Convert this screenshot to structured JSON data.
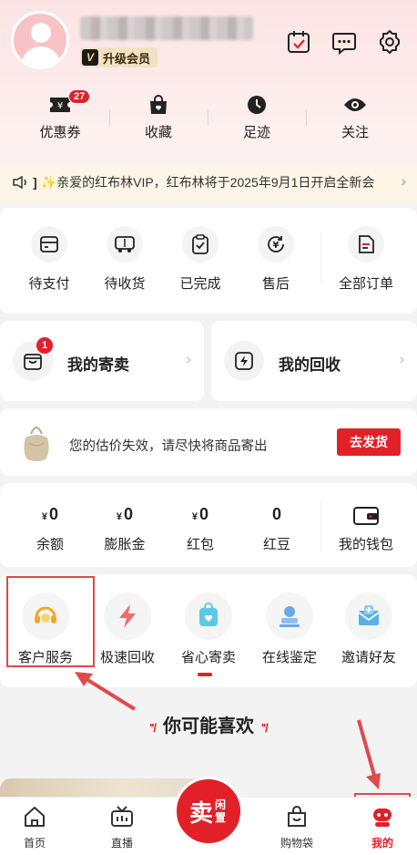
{
  "header": {
    "vip_label": "升级会员",
    "vip_icon_letter": "V"
  },
  "stats": {
    "coupon_label": "优惠券",
    "coupon_count": "27",
    "favorites_label": "收藏",
    "history_label": "足迹",
    "follow_label": "关注"
  },
  "notice": {
    "text": "✨亲爱的红布林VIP，红布林将于2025年9月1日开启全新会"
  },
  "orders": {
    "items": [
      {
        "label": "待支付"
      },
      {
        "label": "待收货"
      },
      {
        "label": "已完成"
      },
      {
        "label": "售后"
      },
      {
        "label": "全部订单"
      }
    ]
  },
  "consign": {
    "label": "我的寄卖",
    "badge": "1"
  },
  "recycle": {
    "label": "我的回收"
  },
  "alert": {
    "text": "您的估价失效，请尽快将商品寄出",
    "button": "去发货"
  },
  "wallet": {
    "currency": "¥",
    "items": [
      {
        "value": "0",
        "label": "余额"
      },
      {
        "value": "0",
        "label": "膨胀金"
      },
      {
        "value": "0",
        "label": "红包"
      },
      {
        "value": "0",
        "label": "红豆"
      }
    ],
    "wallet_label": "我的钱包"
  },
  "services": {
    "items": [
      {
        "label": "客户服务"
      },
      {
        "label": "极速回收"
      },
      {
        "label": "省心寄卖"
      },
      {
        "label": "在线鉴定"
      },
      {
        "label": "邀请好友"
      }
    ]
  },
  "recommend": {
    "title": "你可能喜欢"
  },
  "bottom_nav": {
    "home": "首页",
    "live": "直播",
    "sell_big": "卖",
    "sell_small": "闲置",
    "bag": "购物袋",
    "mine": "我的"
  },
  "colors": {
    "accent": "#e22027",
    "highlight_frame": "#e04a4a"
  }
}
